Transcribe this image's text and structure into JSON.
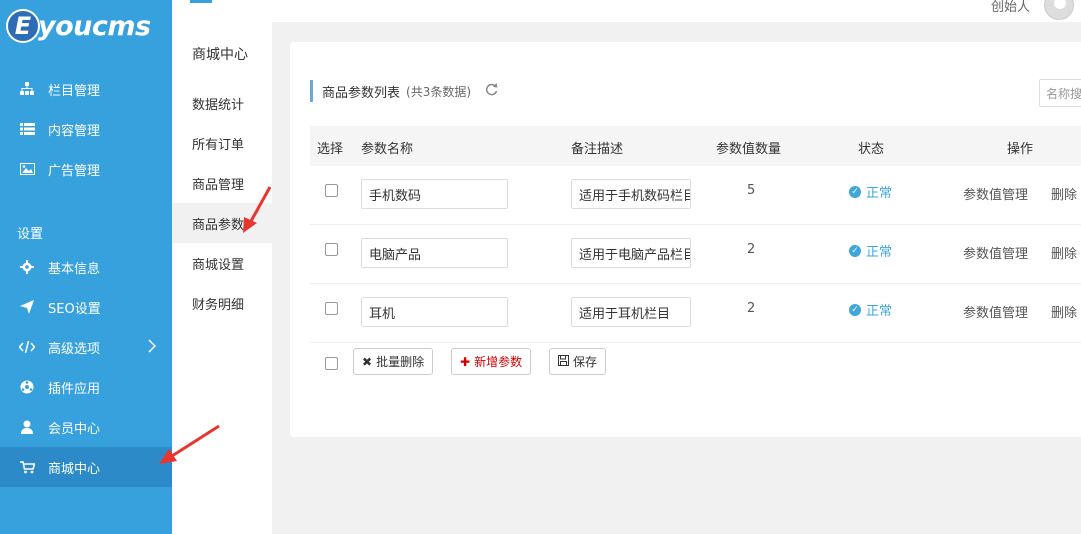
{
  "logo": {
    "letter": "E",
    "text": "youcms"
  },
  "sidebar": {
    "items": [
      {
        "label": "栏目管理",
        "icon": "sitemap-icon"
      },
      {
        "label": "内容管理",
        "icon": "list-icon"
      },
      {
        "label": "广告管理",
        "icon": "image-icon"
      }
    ],
    "section_label": "设置",
    "settings_items": [
      {
        "label": "基本信息",
        "icon": "gear-icon"
      },
      {
        "label": "SEO设置",
        "icon": "send-icon"
      },
      {
        "label": "高级选项",
        "icon": "code-icon"
      },
      {
        "label": "插件应用",
        "icon": "plugin-icon"
      },
      {
        "label": "会员中心",
        "icon": "user-icon"
      },
      {
        "label": "商城中心",
        "icon": "cart-icon"
      }
    ],
    "active": "商城中心"
  },
  "submenu": {
    "title": "商城中心",
    "items": [
      "数据统计",
      "所有订单",
      "商品管理",
      "商品参数",
      "商城设置",
      "财务明细"
    ],
    "active": "商品参数"
  },
  "header": {
    "user_label": "创始人"
  },
  "panel": {
    "title": "商品参数列表",
    "count": "(共3条数据)",
    "search_placeholder": "名称搜"
  },
  "table": {
    "columns": [
      "选择",
      "参数名称",
      "备注描述",
      "参数值数量",
      "状态",
      "操作"
    ],
    "rows": [
      {
        "name": "手机数码",
        "desc": "适用于手机数码栏目",
        "count": "5",
        "status": "正常",
        "action1": "参数值管理",
        "action2": "删除"
      },
      {
        "name": "电脑产品",
        "desc": "适用于电脑产品栏目",
        "count": "2",
        "status": "正常",
        "action1": "参数值管理",
        "action2": "删除"
      },
      {
        "name": "耳机",
        "desc": "适用于耳机栏目",
        "count": "2",
        "status": "正常",
        "action1": "参数值管理",
        "action2": "删除"
      }
    ]
  },
  "footer_buttons": {
    "batch_delete": "批量删除",
    "add": "新增参数",
    "save": "保存"
  },
  "colors": {
    "sidebar": "#37a1dd",
    "sidebar_active": "#2b8ac7",
    "status": "#3ea6d8",
    "add_button": "#d10000",
    "annotation_arrow": "#e8352d"
  }
}
